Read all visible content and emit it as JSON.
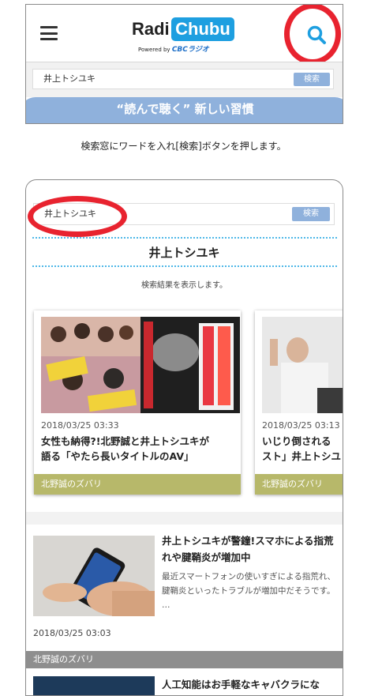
{
  "top_screen": {
    "logo_radi": "Radi",
    "logo_chubu": "Chubu",
    "logo_powered": "Powered by",
    "logo_cbc": "CBCラジオ",
    "search_value": "井上トシユキ",
    "search_button": "検索",
    "banner_text": "“読んで聴く” 新しい習慣"
  },
  "caption": "検索窓にワードを入れ[検索]ボタンを押します。",
  "results_screen": {
    "search_value": "井上トシユキ",
    "search_button": "検索",
    "result_title": "井上トシユキ",
    "result_note": "検索結果を表示します。",
    "cards": [
      {
        "date": "2018/03/25 03:33",
        "title_line1": "女性も納得?!北野誠と井上トシユキが",
        "title_line2": "語る「やたら長いタイトルのAV」",
        "category": "北野誠のズバリ"
      },
      {
        "date": "2018/03/25 03:13",
        "title_line1": "いじり倒される",
        "title_line2": "スト」井上トシユ",
        "category": "北野誠のズバリ"
      }
    ],
    "list_items": [
      {
        "title": "井上トシユキが警鐘!スマホによる指荒れや腱鞘炎が増加中",
        "excerpt": "最近スマートフォンの使いすぎによる指荒れ、腱鞘炎といったトラブルが増加中だそうです。 …",
        "date": "2018/03/25 03:03",
        "category": "北野誠のズバリ"
      },
      {
        "title": "人工知能はお手軽なキャバクラにな"
      }
    ]
  },
  "colors": {
    "accent_blue": "#1e9fe0",
    "button_blue": "#8fb1dc",
    "highlight_red": "#e8232f",
    "category_olive": "#b7b86a",
    "category_gray": "#8e8e8e"
  }
}
